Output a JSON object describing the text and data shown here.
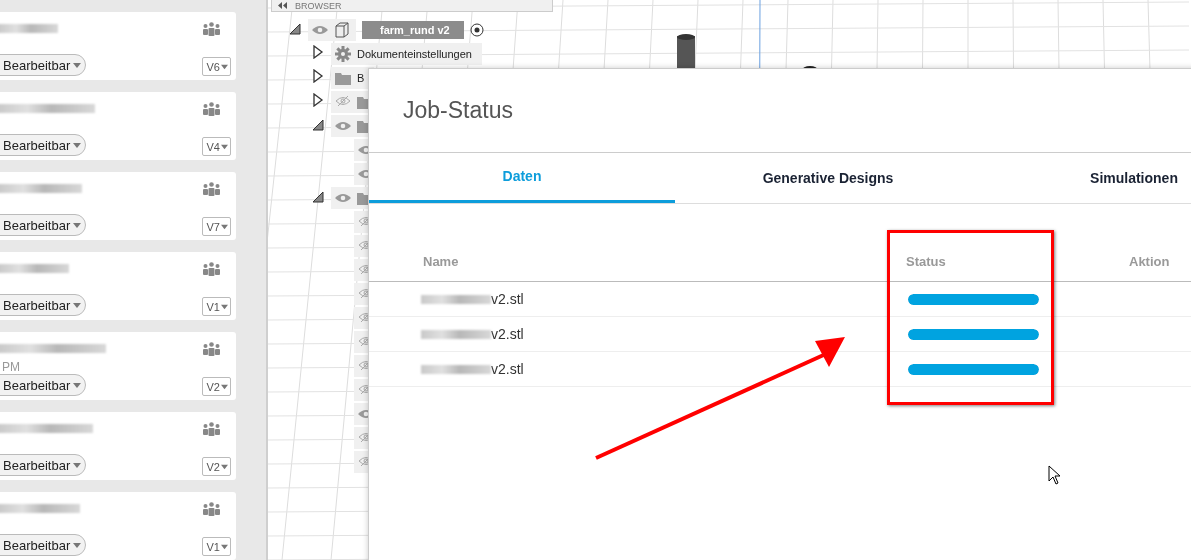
{
  "projects": [
    {
      "access": "Bearbeitbar",
      "version": "V6"
    },
    {
      "access": "Bearbeitbar",
      "version": "V4"
    },
    {
      "access": "Bearbeitbar",
      "version": "V7"
    },
    {
      "access": "Bearbeitbar",
      "version": "V1"
    },
    {
      "time": "PM",
      "access": "Bearbeitbar",
      "version": "V2"
    },
    {
      "access": "Bearbeitbar",
      "version": "V2"
    },
    {
      "access": "Bearbeitbar",
      "version": "V1"
    }
  ],
  "browser": {
    "title": "BROWSER",
    "tree": [
      {
        "kind": "component",
        "label": "farm_rund v2",
        "visible": true,
        "expanded": true,
        "children": [
          {
            "kind": "settings",
            "label": "Dokumenteinstellungen",
            "expanded": false
          },
          {
            "kind": "folder",
            "label": "B",
            "expanded": false
          },
          {
            "kind": "folder",
            "visible": false,
            "expanded": false
          },
          {
            "kind": "folder",
            "visible": true,
            "expanded": true,
            "children": [
              {
                "visible": true
              },
              {
                "visible": true
              }
            ]
          },
          {
            "kind": "folder",
            "visible": true,
            "expanded": true,
            "children": [
              {
                "visible": false
              },
              {
                "visible": false
              },
              {
                "visible": false
              },
              {
                "visible": false
              },
              {
                "visible": false
              },
              {
                "visible": false
              },
              {
                "visible": false
              },
              {
                "visible": false
              },
              {
                "visible": true
              },
              {
                "visible": false
              },
              {
                "visible": false
              }
            ]
          }
        ]
      }
    ]
  },
  "dialog": {
    "title": "Job-Status",
    "tabs": [
      {
        "label": "Daten",
        "selected": true
      },
      {
        "label": "Generative Designs",
        "selected": false
      },
      {
        "label": "Simulationen",
        "selected": false
      }
    ],
    "table": {
      "columns": [
        "Name",
        "Status",
        "Aktion"
      ],
      "rows": [
        {
          "name": "v2.stl",
          "level": 1
        },
        {
          "name": "v2.stl",
          "level": 1
        },
        {
          "name": "v2.stl",
          "level": 1
        }
      ]
    }
  }
}
